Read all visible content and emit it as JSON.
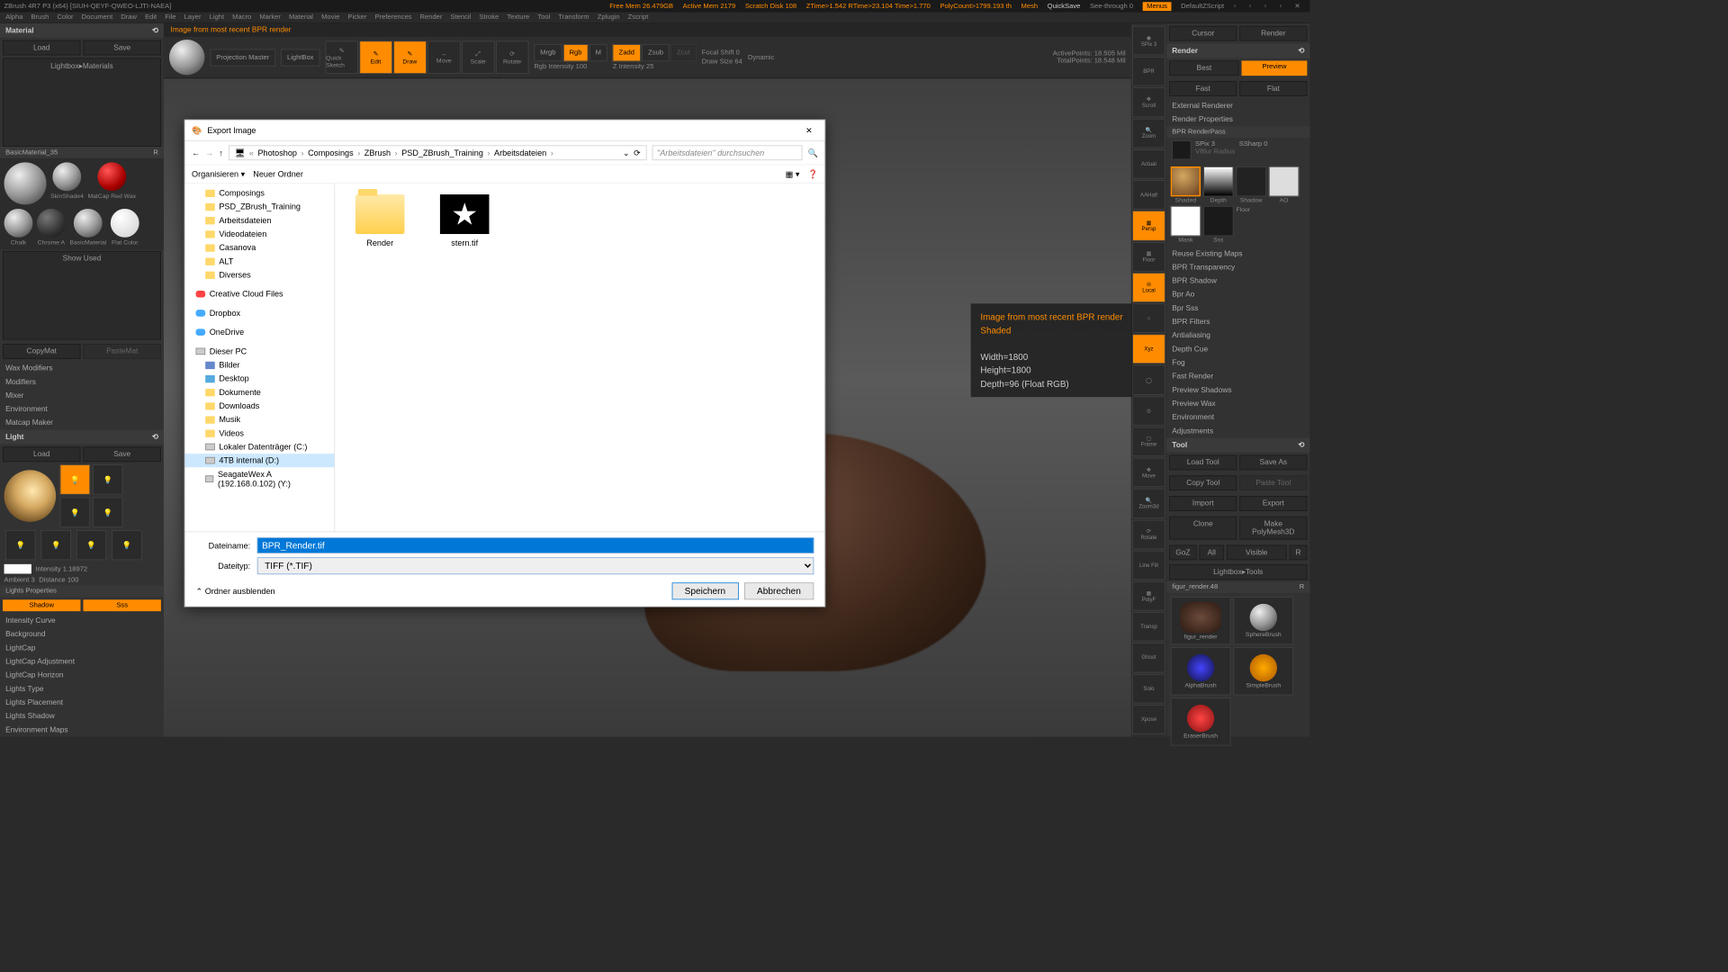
{
  "title_bar": {
    "app": "ZBrush 4R7 P3 (x64) [SIUH-QEYF-QWEO-LJTI-NAEA]",
    "free_mem": "Free Mem 26.479GB",
    "active_mem": "Active Mem 2179",
    "scratch": "Scratch Disk 108",
    "ztime": "ZTime>1.542 RTime>23.104 Time>1.770",
    "polycount": "PolyCount>1799.193 th",
    "mesh": "Mesh",
    "quicksave": "QuickSave",
    "seethrough": "See-through 0",
    "menus": "Menus",
    "script": "DefaultZScript"
  },
  "menus": [
    "Alpha",
    "Brush",
    "Color",
    "Document",
    "Draw",
    "Edit",
    "File",
    "Layer",
    "Light",
    "Macro",
    "Marker",
    "Material",
    "Movie",
    "Picker",
    "Preferences",
    "Render",
    "Stencil",
    "Stroke",
    "Texture",
    "Tool",
    "Transform",
    "Zplugin",
    "Zscript"
  ],
  "status": "Image from most recent BPR render",
  "shelf": {
    "projection": "Projection Master",
    "lightbox": "LightBox",
    "quicksketch": "Quick Sketch",
    "edit": "Edit",
    "draw": "Draw",
    "move": "Move",
    "scale": "Scale",
    "rotate": "Rotate",
    "mrgb": "Mrgb",
    "rgb": "Rgb",
    "m": "M",
    "rgb_int": "Rgb Intensity 100",
    "zadd": "Zadd",
    "zsub": "Zsub",
    "zcut": "Zcut",
    "z_int": "Z Intensity 25",
    "focal": "Focal Shift 0",
    "drawsize": "Draw Size 64",
    "dynamic": "Dynamic",
    "activepoints": "ActivePoints: 18.505 Mil",
    "totalpoints": "TotalPoints: 18.548 Mil"
  },
  "left": {
    "material": "Material",
    "load": "Load",
    "save": "Save",
    "lightbox_mat": "Lightbox▸Materials",
    "basicmat": "BasicMaterial_35",
    "r": "R",
    "skinshade": "SkinShade4",
    "matcap_red": "MatCap Red Wax",
    "chalk": "Chalk",
    "chrome": "Chrome A",
    "basic": "BasicMaterial",
    "flat": "Flat Color",
    "show_used": "Show Used",
    "copymat": "CopyMat",
    "pastemat": "PasteMat",
    "wax": "Wax Modifiers",
    "modifiers": "Modifiers",
    "mixer": "Mixer",
    "environment": "Environment",
    "matcap_maker": "Matcap Maker",
    "light": "Light",
    "intensity": "Intensity 1.18972",
    "ambient": "Ambient 3",
    "distance": "Distance 100",
    "lights_props": "Lights Properties",
    "shadow": "Shadow",
    "sss": "Sss",
    "intensity_curve": "Intensity Curve",
    "background": "Background",
    "lightcap": "LightCap",
    "lightcap_adj": "LightCap Adjustment",
    "lightcap_hor": "LightCap Horizon",
    "lights_type": "Lights Type",
    "lights_place": "Lights Placement",
    "lights_shadow": "Lights Shadow",
    "env_maps": "Environment Maps"
  },
  "strip": {
    "spix": "SPix 3",
    "bpr": "BPR",
    "scroll": "Scroll",
    "zoom": "Zoom",
    "actual": "Actual",
    "aahalf": "AAHalf",
    "persp": "Persp",
    "floor": "Floor",
    "local": "Local",
    "xyz": "Xyz",
    "frame": "Frame",
    "move": "Move",
    "zoom3d": "Zoom3d",
    "rotate": "Rotate",
    "linefill": "Line Fill",
    "polyf": "PolyF",
    "transp": "Transp",
    "ghost": "Ghost",
    "solo": "Solo",
    "xpose": "Xpose"
  },
  "right": {
    "cursor": "Cursor",
    "render": "Render",
    "best": "Best",
    "preview": "Preview",
    "fast": "Fast",
    "flat": "Flat",
    "ext_renderer": "External Renderer",
    "render_props": "Render Properties",
    "bpr_pass": "BPR RenderPass",
    "spix": "SPix 3",
    "ssharp": "SSharp 0",
    "vblur": "VBlur Radius",
    "shaded": "Shaded",
    "depth": "Depth",
    "shadow_t": "Shadow",
    "ao_t": "AO",
    "mask_t": "Mask",
    "sss_t": "Sss",
    "floor_t": "Floor",
    "reuse": "Reuse Existing Maps",
    "bpr_trans": "BPR Transparency",
    "bpr_shadow": "BPR Shadow",
    "bpr_ao": "Bpr Ao",
    "bpr_sss": "Bpr Sss",
    "bpr_filters": "BPR Filters",
    "antialiasing": "Antialiasing",
    "depth_cue": "Depth Cue",
    "fog": "Fog",
    "fast_render": "Fast Render",
    "preview_shadows": "Preview Shadows",
    "preview_wax": "Preview Wax",
    "environment": "Environment",
    "adjustments": "Adjustments",
    "tool": "Tool",
    "load_tool": "Load Tool",
    "save_as": "Save As",
    "copy_tool": "Copy Tool",
    "paste_tool": "Paste Tool",
    "import": "Import",
    "export": "Export",
    "clone": "Clone",
    "make_polymesh": "Make PolyMesh3D",
    "goz": "GoZ",
    "all": "All",
    "visible": "Visible",
    "r_btn": "R",
    "lightbox_tools": "Lightbox▸Tools",
    "figur": "figur_render.48",
    "figur_thumb": "figur_render",
    "sphere": "SphereBrush",
    "alpha": "AlphaBrush",
    "simple": "SimpleBrush",
    "eraser": "EraserBrush"
  },
  "tooltip": {
    "l1": "Image from most recent BPR render",
    "l2": "Shaded",
    "l3": "Width=1800",
    "l4": "Height=1800",
    "l5": "Depth=96 (Float RGB)"
  },
  "dialog": {
    "title": "Export Image",
    "crumbs": [
      "Photoshop",
      "Composings",
      "ZBrush",
      "PSD_ZBrush_Training",
      "Arbeitsdateien"
    ],
    "search_ph": "\"Arbeitsdateien\" durchsuchen",
    "organize": "Organisieren",
    "new_folder": "Neuer Ordner",
    "tree": {
      "composings": "Composings",
      "psd": "PSD_ZBrush_Training",
      "arbeit": "Arbeitsdateien",
      "video": "Videodateien",
      "casanova": "Casanova",
      "alt": "ALT",
      "diverses": "Diverses",
      "cc": "Creative Cloud Files",
      "dropbox": "Dropbox",
      "onedrive": "OneDrive",
      "pc": "Dieser PC",
      "bilder": "Bilder",
      "desktop": "Desktop",
      "dokumente": "Dokumente",
      "downloads": "Downloads",
      "musik": "Musik",
      "videos": "Videos",
      "local_c": "Lokaler Datenträger (C:)",
      "drive_d": "4TB internal (D:)",
      "seagate": "SeagateWex A (192.168.0.102) (Y:)"
    },
    "files": {
      "render": "Render",
      "stern": "stern.tif"
    },
    "filename_label": "Dateiname:",
    "filename": "BPR_Render.tif",
    "filetype_label": "Dateityp:",
    "filetype": "TIFF (*.TIF)",
    "hide_folders": "Ordner ausblenden",
    "save": "Speichern",
    "cancel": "Abbrechen"
  }
}
